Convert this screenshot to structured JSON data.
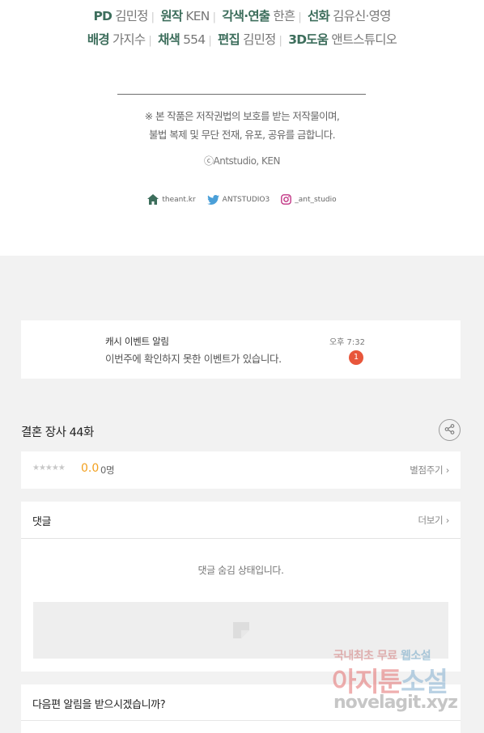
{
  "credits": {
    "line1": [
      {
        "role": "PD",
        "name": "김민정"
      },
      {
        "role": "원작",
        "name": "KEN"
      },
      {
        "role": "각색·연출",
        "name": "한흔"
      },
      {
        "role": "선화",
        "name": "김유신·영영"
      }
    ],
    "line2": [
      {
        "role": "배경",
        "name": "가지수"
      },
      {
        "role": "채색",
        "name": "554"
      },
      {
        "role": "편집",
        "name": "김민정"
      },
      {
        "role": "3D도움",
        "name": "앤트스튜디오"
      }
    ],
    "notice_line1": "※ 본 작품은 저작권법의 보호를 받는 저작물이며,",
    "notice_line2": "불법 복제 및 무단 전재, 유포, 공유를 금합니다.",
    "copyright": "ⓒAntstudio, KEN",
    "social": [
      {
        "icon": "home-icon",
        "label": "theant.kr"
      },
      {
        "icon": "twitter-icon",
        "label": "ANTSTUDIO3"
      },
      {
        "icon": "instagram-icon",
        "label": "_ant_studio"
      }
    ]
  },
  "notification": {
    "title": "캐시 이벤트 알림",
    "message": "이번주에 확인하지 못한 이벤트가 있습니다.",
    "time": "오후 7:32",
    "badge": "1"
  },
  "episode": {
    "title": "결혼 장사 44화",
    "share_icon": "share-icon"
  },
  "rating": {
    "stars": "★★★★★",
    "score": "0.0",
    "count": "0명",
    "rate_link": "별점주기 ›"
  },
  "comments": {
    "label": "댓글",
    "more": "더보기 ›",
    "hidden_message": "댓글 숨김 상태입니다."
  },
  "subscribe": {
    "question": "다음편 알림을 받으시겠습니까?"
  },
  "watermark": {
    "line1_a": "국내최초 무료 ",
    "line1_b": "웹소설",
    "line2_a": "아지툰",
    "line2_b": "소설",
    "line3": "novelagit.xyz"
  },
  "colors": {
    "credit_role": "#3d6e5c",
    "badge": "#e8563b",
    "score": "#f2a01f",
    "page_bg": "#f2f2f2"
  }
}
